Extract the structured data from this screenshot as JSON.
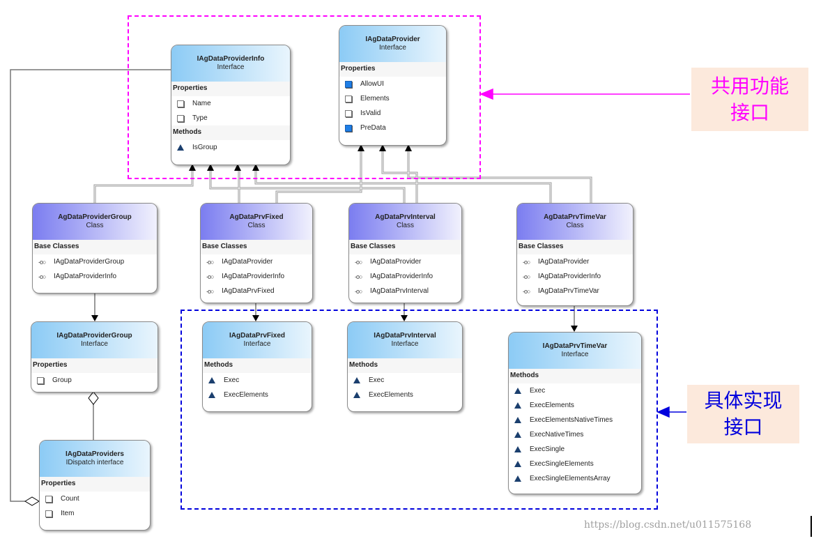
{
  "groups": {
    "shared_label": "共用功能\n接口",
    "impl_label": "具体实现\n接口",
    "shared_color": "#ff00ff",
    "impl_color": "#0000dd"
  },
  "watermark": "https://blog.csdn.net/u011575168",
  "boxes": [
    {
      "id": "iagdataproviderinfo",
      "name": "IAgDataProviderInfo",
      "kind": "Interface",
      "style": "iface",
      "sections": [
        {
          "title": "Properties",
          "items": [
            {
              "label": "Name",
              "icon": "property"
            },
            {
              "label": "Type",
              "icon": "property"
            }
          ]
        },
        {
          "title": "Methods",
          "items": [
            {
              "label": "IsGroup",
              "icon": "method"
            }
          ]
        }
      ]
    },
    {
      "id": "iagdataprovider",
      "name": "IAgDataProvider",
      "kind": "Interface",
      "style": "iface",
      "sections": [
        {
          "title": "Properties",
          "items": [
            {
              "label": "AllowUI",
              "icon": "property-public"
            },
            {
              "label": "Elements",
              "icon": "property"
            },
            {
              "label": "IsValid",
              "icon": "property"
            },
            {
              "label": "PreData",
              "icon": "property-public"
            }
          ]
        }
      ]
    },
    {
      "id": "agdataprovidergroup",
      "name": "AgDataProviderGroup",
      "kind": "Class",
      "style": "cls",
      "sections": [
        {
          "title": "Base Classes",
          "items": [
            {
              "label": "IAgDataProviderGroup",
              "icon": "interface"
            },
            {
              "label": "IAgDataProviderInfo",
              "icon": "interface"
            }
          ]
        }
      ]
    },
    {
      "id": "agdataprvfixed",
      "name": "AgDataPrvFixed",
      "kind": "Class",
      "style": "cls",
      "sections": [
        {
          "title": "Base Classes",
          "items": [
            {
              "label": "IAgDataProvider",
              "icon": "interface"
            },
            {
              "label": "IAgDataProviderInfo",
              "icon": "interface"
            },
            {
              "label": "IAgDataPrvFixed",
              "icon": "interface"
            }
          ]
        }
      ]
    },
    {
      "id": "agdataprvinterval",
      "name": "AgDataPrvInterval",
      "kind": "Class",
      "style": "cls",
      "sections": [
        {
          "title": "Base Classes",
          "items": [
            {
              "label": "IAgDataProvider",
              "icon": "interface"
            },
            {
              "label": "IAgDataProviderInfo",
              "icon": "interface"
            },
            {
              "label": "IAgDataPrvInterval",
              "icon": "interface"
            }
          ]
        }
      ]
    },
    {
      "id": "agdataprvtimevar",
      "name": "AgDataPrvTimeVar",
      "kind": "Class",
      "style": "cls",
      "sections": [
        {
          "title": "Base Classes",
          "items": [
            {
              "label": "IAgDataProvider",
              "icon": "interface"
            },
            {
              "label": "IAgDataProviderInfo",
              "icon": "interface"
            },
            {
              "label": "IAgDataPrvTimeVar",
              "icon": "interface"
            }
          ]
        }
      ]
    },
    {
      "id": "iagdataprovidergroup",
      "name": "IAgDataProviderGroup",
      "kind": "Interface",
      "style": "iface",
      "sections": [
        {
          "title": "Properties",
          "items": [
            {
              "label": "Group",
              "icon": "property"
            }
          ]
        }
      ]
    },
    {
      "id": "iagdataprvfixed",
      "name": "IAgDataPrvFixed",
      "kind": "Interface",
      "style": "iface",
      "sections": [
        {
          "title": "Methods",
          "items": [
            {
              "label": "Exec",
              "icon": "method"
            },
            {
              "label": "ExecElements",
              "icon": "method"
            }
          ]
        }
      ]
    },
    {
      "id": "iagdataprvinterval",
      "name": "IAgDataPrvInterval",
      "kind": "Interface",
      "style": "iface",
      "sections": [
        {
          "title": "Methods",
          "items": [
            {
              "label": "Exec",
              "icon": "method"
            },
            {
              "label": "ExecElements",
              "icon": "method"
            }
          ]
        }
      ]
    },
    {
      "id": "iagdataprvtimevar",
      "name": "IAgDataPrvTimeVar",
      "kind": "Interface",
      "style": "iface",
      "sections": [
        {
          "title": "Methods",
          "items": [
            {
              "label": "Exec",
              "icon": "method"
            },
            {
              "label": "ExecElements",
              "icon": "method"
            },
            {
              "label": "ExecElementsNativeTimes",
              "icon": "method"
            },
            {
              "label": "ExecNativeTimes",
              "icon": "method"
            },
            {
              "label": "ExecSingle",
              "icon": "method"
            },
            {
              "label": "ExecSingleElements",
              "icon": "method"
            },
            {
              "label": "ExecSingleElementsArray",
              "icon": "method"
            }
          ]
        }
      ]
    },
    {
      "id": "iagdataproviders",
      "name": "IAgDataProviders",
      "kind": "IDispatch  interface",
      "style": "iface",
      "sections": [
        {
          "title": "Properties",
          "items": [
            {
              "label": "Count",
              "icon": "property"
            },
            {
              "label": "Item",
              "icon": "property"
            }
          ]
        }
      ]
    }
  ]
}
